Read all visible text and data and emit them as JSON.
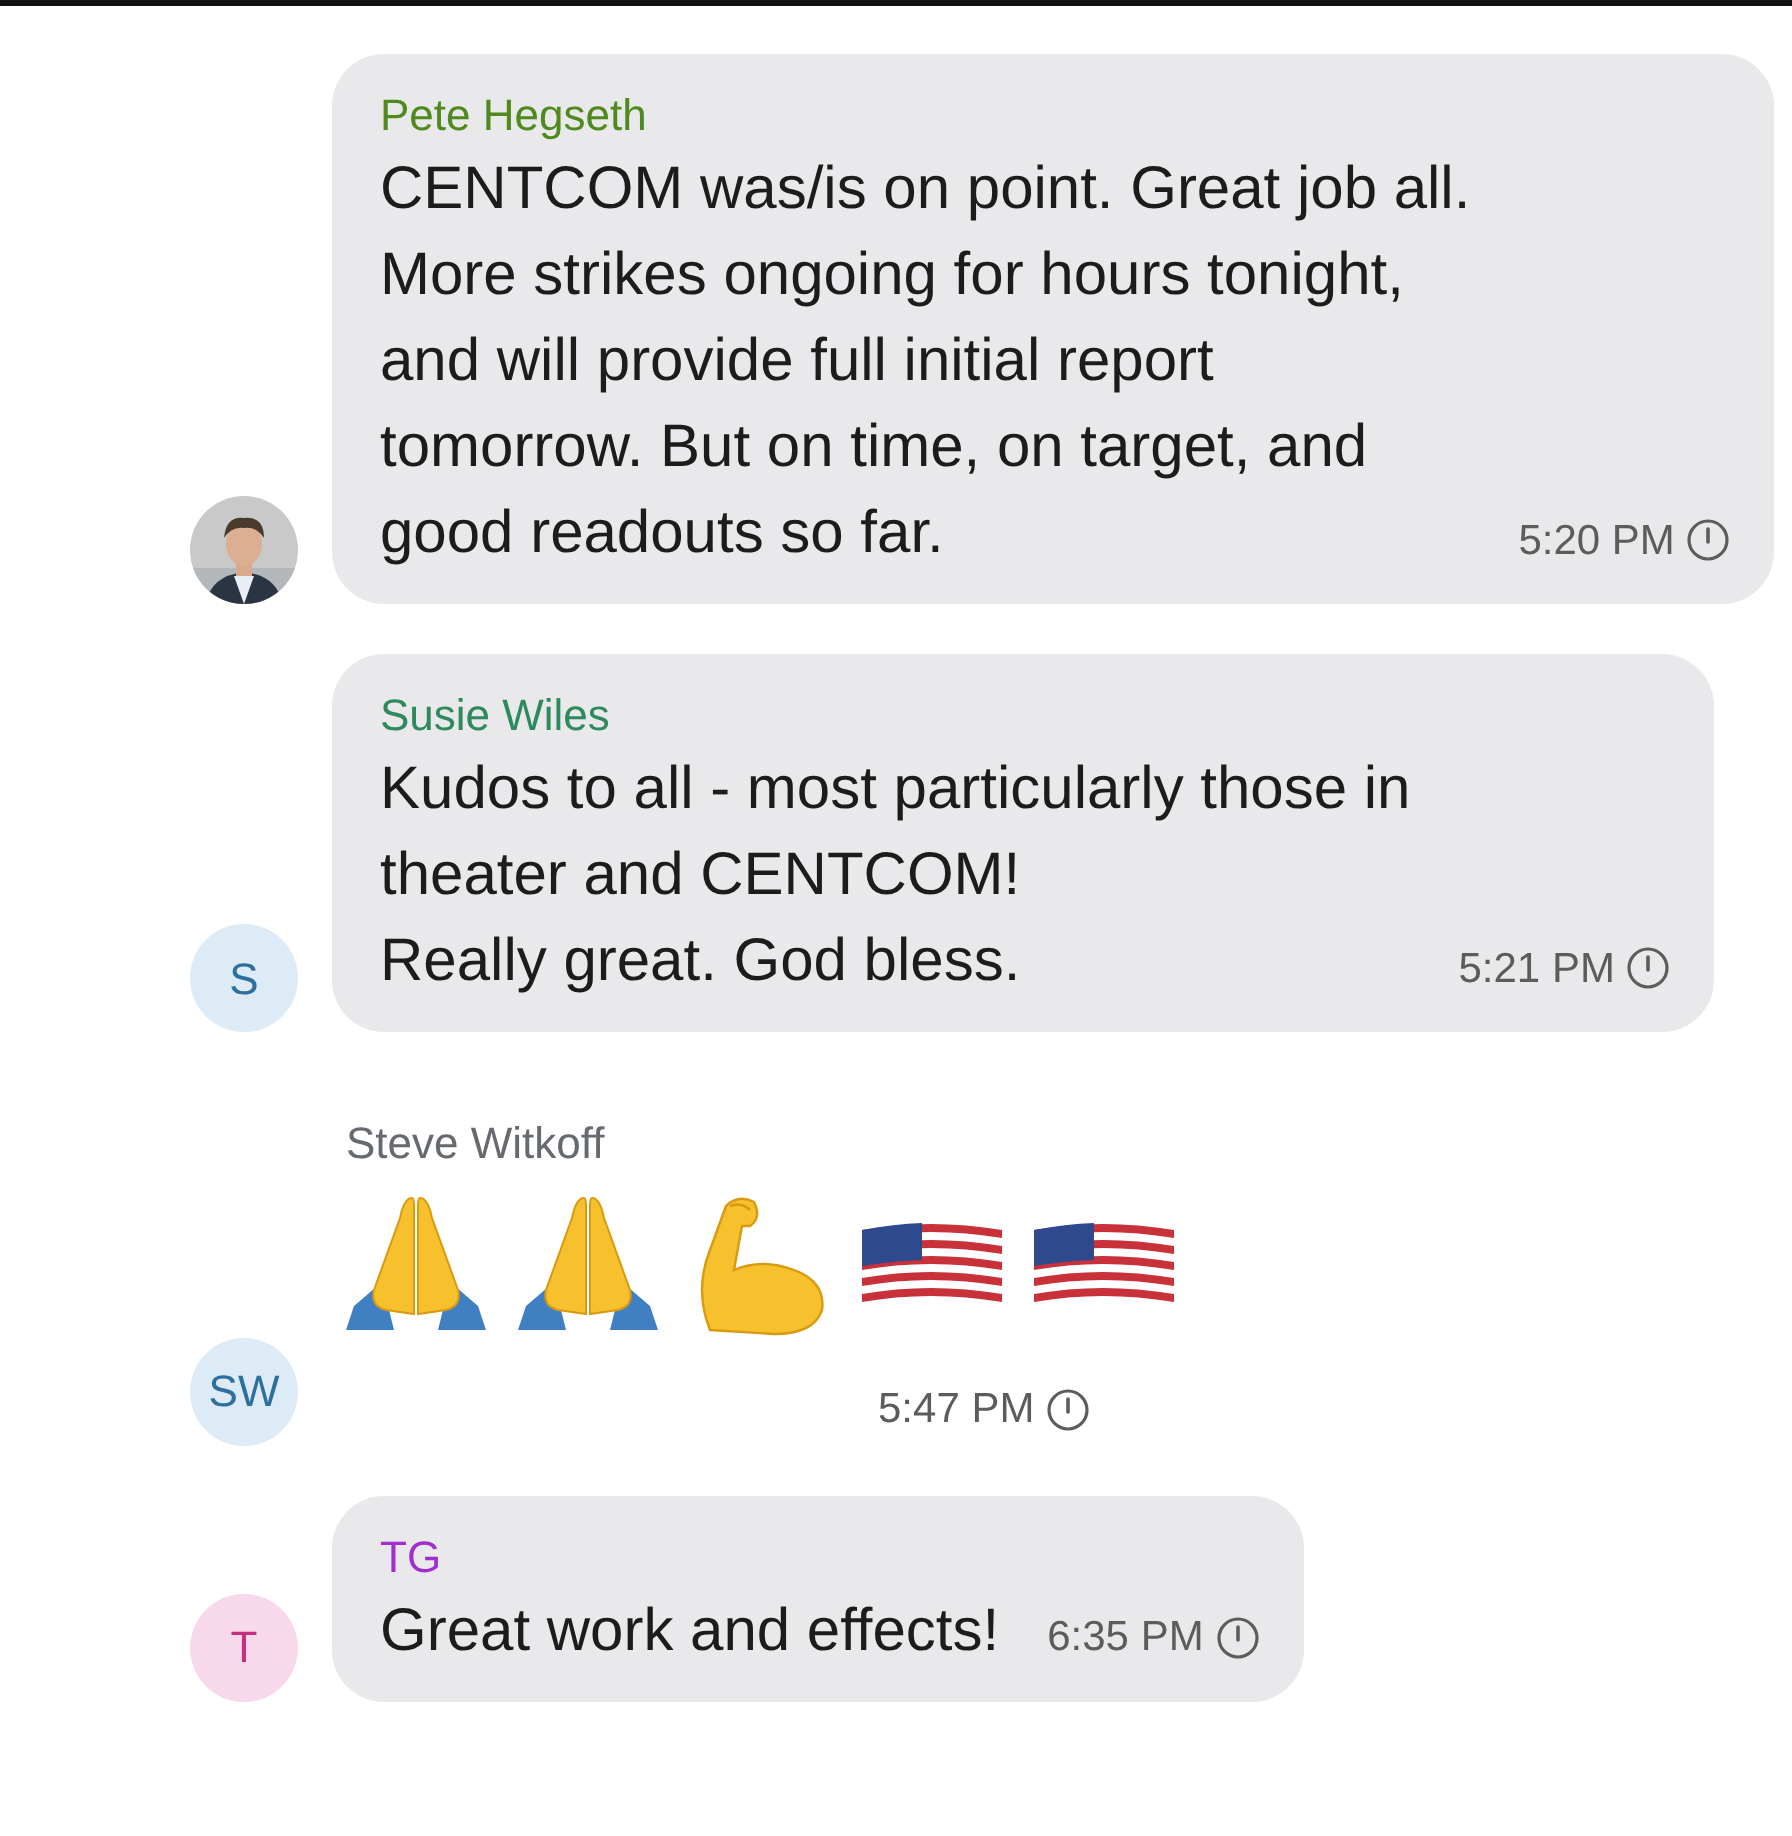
{
  "messages": [
    {
      "kind": "bubble",
      "sender": "Pete Hegseth",
      "color": "#4e8a1e",
      "lines": [
        "CENTCOM was/is on point. Great job all.",
        "More strikes ongoing for hours tonight,",
        "and will provide full initial report",
        "tomorrow. But on time, on target, and",
        "good readouts so far."
      ],
      "time": "5:20 PM"
    },
    {
      "kind": "bubble",
      "sender": "Susie Wiles",
      "color": "#2e8a5c",
      "avatar": {
        "kind": "initials",
        "text": "S",
        "color": "#2f6f9e"
      },
      "lines": [
        "Kudos to all - most particularly those in",
        "theater and CENTCOM!",
        "Really great. God bless."
      ],
      "time": "5:21 PM"
    },
    {
      "kind": "emoji",
      "sender": "Steve Witkoff",
      "color": "#666a6e",
      "avatar": {
        "kind": "initials",
        "text": "SW",
        "color": "#2f6f9e"
      },
      "emojis": [
        {
          "kind": "pray"
        },
        {
          "kind": "pray"
        },
        {
          "kind": "flex"
        },
        {
          "kind": "flag"
        },
        {
          "kind": "flag"
        }
      ],
      "time": "5:47 PM"
    },
    {
      "kind": "bubble",
      "sender": "TG",
      "color": "#a12fd0",
      "avatar": {
        "kind": "initials",
        "text": "T",
        "color": "#c4307f"
      },
      "lines": [
        "Great work and effects!"
      ],
      "time": "6:35 PM"
    }
  ]
}
